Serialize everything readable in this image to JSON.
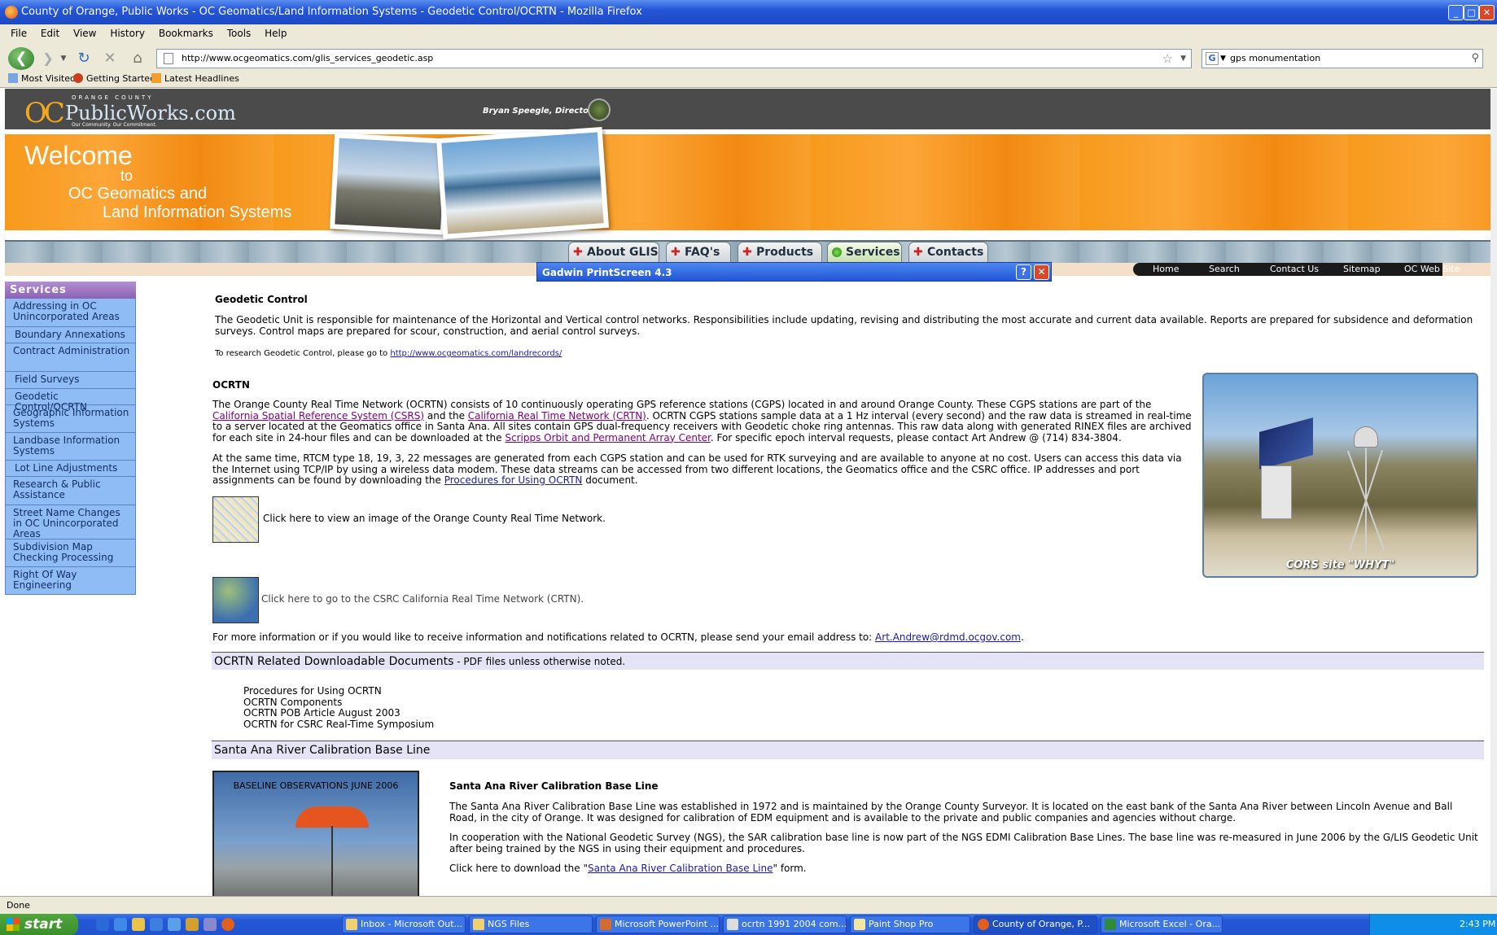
{
  "window": {
    "title": "County of Orange, Public Works - OC Geomatics/Land Information Systems - Geodetic Control/OCRTN - Mozilla Firefox"
  },
  "menu": [
    "File",
    "Edit",
    "View",
    "History",
    "Bookmarks",
    "Tools",
    "Help"
  ],
  "address": {
    "url": "http://www.ocgeomatics.com/glis_services_geodetic.asp"
  },
  "search": {
    "value": "gps monumentation"
  },
  "bookmarks": [
    "Most Visited",
    "Getting Started",
    "Latest Headlines"
  ],
  "site": {
    "logo_top": "ORANGE COUNTY",
    "logo_main": "PublicWorks.com",
    "logo_oc": "OC",
    "logo_tag": "Our Community. Our Commitment.",
    "director": "Bryan Speegle, Director",
    "welcome": [
      "Welcome",
      "to",
      "OC Geomatics and",
      "Land Information Systems"
    ],
    "tabs": [
      "About GLIS",
      "FAQ's",
      "Products",
      "Services",
      "Contacts"
    ],
    "toplinks": [
      "Home",
      "Search",
      "Contact Us",
      "Sitemap",
      "OC Web Site"
    ]
  },
  "gadwin": {
    "title": "Gadwin PrintScreen 4.3",
    "help": "?",
    "close": "✕"
  },
  "sidebar": {
    "heading": "Services",
    "items": [
      "Addressing in OC Unincorporated Areas",
      "Boundary Annexations",
      "Contract Administration",
      "Field Surveys",
      "Geodetic Control/OCRTN",
      "Geographic Information Systems",
      "Landbase Information Systems",
      "Lot Line Adjustments",
      "Research & Public Assistance",
      "Street Name Changes in OC Unincorporated Areas",
      "Subdivision Map Checking Processing",
      "Right Of Way Engineering"
    ]
  },
  "content": {
    "geo_heading": "Geodetic Control",
    "geo_para": "The Geodetic Unit is responsible for maintenance of the Horizontal and Vertical control networks. Responsibilities include updating, revising and distributing the most accurate and current data available. Reports are prepared for subsidence and deformation surveys. Control maps are prepared for scour, construction, and aerial control surveys.",
    "research_text": "To research Geodetic Control, please go to ",
    "research_link": "http://www.ocgeomatics.com/landrecords/",
    "ocrtn_heading": "OCRTN",
    "p1_a": "The Orange County Real Time Network (OCRTN) consists of 10 continuously operating GPS reference stations (CGPS) located in and around Orange County. These CGPS stations are part of the ",
    "p1_link1": "California Spatial Reference System (CSRS)",
    "p1_b": " and the ",
    "p1_link2": "California Real Time Network (CRTN)",
    "p1_c": ". OCRTN CGPS stations sample data at a 1 Hz interval (every second) and the raw data is streamed in real-time to a server located at the Geomatics office in Santa Ana. All sites contain GPS dual-frequency receivers with Geodetic choke ring antennas. This raw data along with generated RINEX files are archived for each site in 24-hour files and can be downloaded at the ",
    "p1_link3": "Scripps Orbit and Permanent Array Center",
    "p1_d": ". For specific epoch interval requests, please contact Art Andrew @ (714) 834-3804.",
    "p2_a": "At the same time, RTCM type 18, 19, 3, 22 messages are generated from each CGPS station and can be used for RTK surveying and are available to anyone at no cost. Users can access this data via the Internet using TCP/IP by using a wireless data modem. These data streams can be accessed from two different locations, the Geomatics office and the CSRC office. IP addresses and port assignments can be found by downloading the ",
    "p2_link": "Procedures for Using OCRTN",
    "p2_b": " document.",
    "img1_text": "Click here to view an image of the Orange County Real Time Network.",
    "img2_text": "Click here to go to the CSRC California Real Time Network (CRTN).",
    "email_text": "For more information or if you would like to receive information and notifications related to OCRTN, please send your email address to: ",
    "email_link": "Art.Andrew@rdmd.ocgov.com",
    "email_end": ".",
    "cors_caption": "CORS site \"WHYT\"",
    "docs_heading": "OCRTN Related Downloadable Documents",
    "docs_sub": " - PDF files unless otherwise noted.",
    "docs": [
      "Procedures for Using OCRTN",
      "OCRTN Components",
      "OCRTN POB Article August 2003",
      "OCRTN for CSRC Real-Time Symposium"
    ],
    "sar_heading": "Santa Ana River Calibration Base Line",
    "baseline_caption": "BASELINE OBSERVATIONS JUNE 2006",
    "sar_sub": "Santa Ana River Calibration Base Line",
    "sar_p1": "The Santa Ana River Calibration Base Line was established in 1972 and is maintained by the Orange County Surveyor. It is located on the east bank of the Santa Ana River between Lincoln Avenue and Ball Road, in the city of Orange. It was designed for calibration of EDM equipment and is available to the private and public companies and agencies without charge.",
    "sar_p2": "In cooperation with the National Geodetic Survey (NGS), the SAR calibration base line is now part of the NGS EDMI Calibration Base Lines. The base line was re-measured in June 2006 by the G/LIS Geodetic Unit after being trained by the NGS in using their equipment and procedures.",
    "sar_p3_a": "Click here to download the \"",
    "sar_p3_link": "Santa Ana River Calibration Base Line",
    "sar_p3_b": "\" form."
  },
  "status": {
    "text": "Done"
  },
  "taskbar": {
    "start": "start",
    "tasks": [
      "Inbox - Microsoft Out...",
      "NGS Files",
      "Microsoft PowerPoint ...",
      "ocrtn 1991 2004 com...",
      "Paint Shop Pro",
      "County of Orange, P...",
      "Microsoft Excel - Ora..."
    ],
    "clock": "2:43 PM"
  }
}
